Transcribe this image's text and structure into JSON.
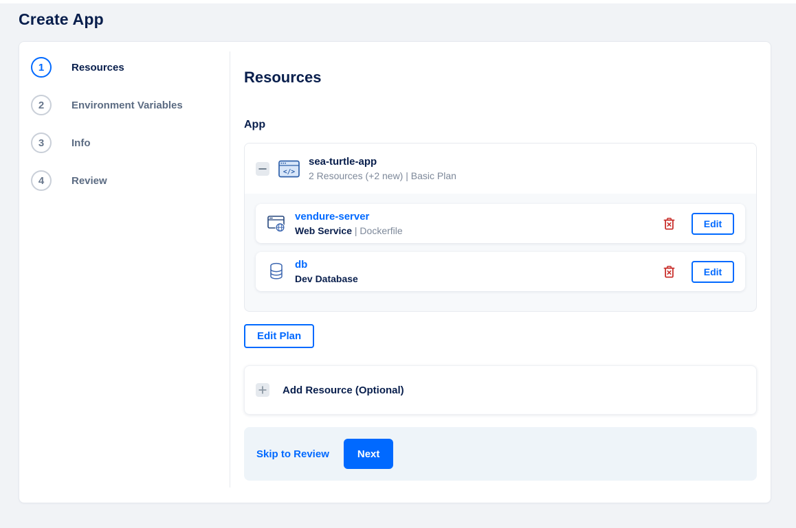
{
  "page_title": "Create App",
  "stepper": {
    "steps": [
      {
        "number": "1",
        "label": "Resources",
        "active": true
      },
      {
        "number": "2",
        "label": "Environment Variables",
        "active": false
      },
      {
        "number": "3",
        "label": "Info",
        "active": false
      },
      {
        "number": "4",
        "label": "Review",
        "active": false
      }
    ]
  },
  "main": {
    "heading": "Resources",
    "section_label": "App",
    "app_group": {
      "name": "sea-turtle-app",
      "summary": "2 Resources (+2 new) | Basic Plan",
      "collapse_icon": "minus-icon",
      "app_icon": "code-window-icon",
      "resources": [
        {
          "name": "vendure-server",
          "type": "Web Service",
          "detail": " | Dockerfile",
          "icon": "web-service-icon",
          "delete_icon": "trash-icon",
          "edit_label": "Edit"
        },
        {
          "name": "db",
          "type": "Dev Database",
          "detail": "",
          "icon": "database-icon",
          "delete_icon": "trash-icon",
          "edit_label": "Edit"
        }
      ]
    },
    "edit_plan_label": "Edit Plan",
    "add_resource": {
      "icon": "plus-icon",
      "label": "Add Resource (Optional)"
    },
    "footer": {
      "skip_label": "Skip to Review",
      "next_label": "Next"
    }
  },
  "colors": {
    "accent_blue": "#0069ff",
    "navy_text": "#081e4c",
    "muted_text": "#7d8899",
    "danger_red": "#c9302c",
    "page_background": "#f1f3f6",
    "footer_band": "#eef4f9",
    "group_body": "#f7f9fb",
    "border": "#e6e9ee"
  }
}
